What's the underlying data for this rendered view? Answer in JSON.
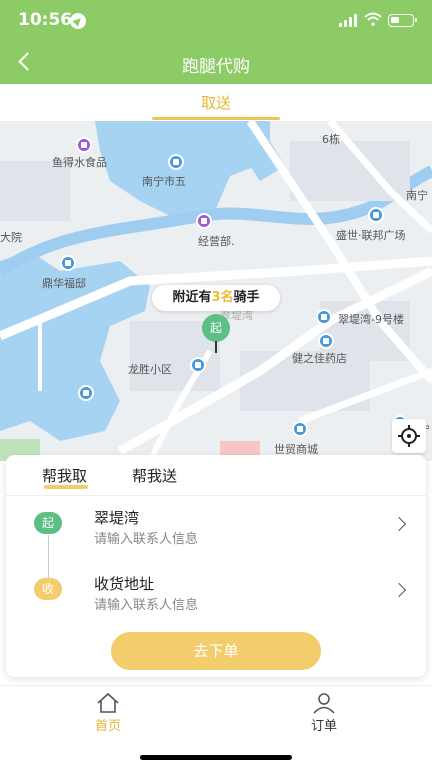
{
  "status_bar": {
    "time": "10:56"
  },
  "header": {
    "title": "跑腿代购",
    "back_icon": "chevron-left-icon"
  },
  "top_tabs": [
    {
      "label": "取送",
      "active": true
    }
  ],
  "map": {
    "labels": {
      "fish_shop": "鱼得水食品",
      "nanning5": "南宁市五",
      "6dong": "6栋",
      "nanning_right": "南宁",
      "business": "经营部.",
      "dayuan": "大院",
      "shengshi": "盛世·联邦广场",
      "dinghua": "鼎华福邸",
      "cuitiwan9": "翠堤湾-9号楼",
      "cuitiwan_faint": "翠堤湾",
      "jianzhijia": "健之佳药店",
      "longsheng": "龙胜小区",
      "shimao": "世贸商城",
      "nanning_small": "南宁"
    },
    "rider_notice": {
      "prefix": "附近有",
      "count": "3名",
      "suffix": "骑手"
    },
    "start_pin_label": "起",
    "locate_icon": "crosshair-icon"
  },
  "order_card": {
    "mode_tabs": [
      {
        "label": "帮我取",
        "active": true
      },
      {
        "label": "帮我送",
        "active": false
      }
    ],
    "pickup": {
      "badge": "起",
      "title": "翠堤湾",
      "subtitle": "请输入联系人信息"
    },
    "delivery": {
      "badge": "收",
      "title": "收货地址",
      "subtitle": "请输入联系人信息"
    },
    "submit_label": "去下单"
  },
  "bottom_nav": [
    {
      "label": "首页",
      "icon": "home-icon",
      "active": true
    },
    {
      "label": "订单",
      "icon": "user-icon",
      "active": false
    }
  ],
  "colors": {
    "header": "#8ccb66",
    "accent": "#f3cd6b",
    "start_green": "#5dbf86",
    "active_text": "#e8b73a"
  }
}
